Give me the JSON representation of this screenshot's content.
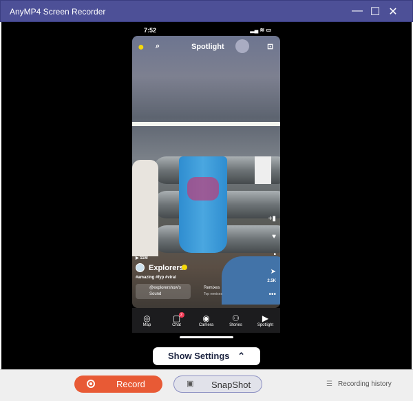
{
  "window": {
    "title": "AnyMP4 Screen Recorder",
    "minimize": "—",
    "maximize": "☐",
    "close": "✕"
  },
  "phone": {
    "time": "7:52",
    "header_title": "Spotlight",
    "views": "▶ 11M",
    "creator": "Explorers",
    "hashtags": "#amazing #fyp #viral",
    "sound_line1": "@explorershow's",
    "sound_line2": "Sound",
    "remixes": "Remixes",
    "remixes_sub": "Top remixes",
    "share_count": "2.5K",
    "nav": [
      {
        "label": "Map",
        "icon": "map-pin-icon",
        "glyph": "◎"
      },
      {
        "label": "Chat",
        "icon": "chat-icon",
        "glyph": "▢",
        "badge": "2"
      },
      {
        "label": "Camera",
        "icon": "camera-icon",
        "glyph": "◉"
      },
      {
        "label": "Stories",
        "icon": "stories-icon",
        "glyph": "⚇"
      },
      {
        "label": "Spotlight",
        "icon": "spotlight-icon",
        "glyph": "▶"
      }
    ]
  },
  "show_settings": {
    "label": "Show Settings",
    "icon": "chevron-up-icon"
  },
  "bottom": {
    "record": "Record",
    "snapshot": "SnapShot",
    "history": "Recording history"
  },
  "colors": {
    "titlebar": "#4d5097",
    "record": "#e85a35",
    "snapshot_border": "#8b8fc2"
  }
}
